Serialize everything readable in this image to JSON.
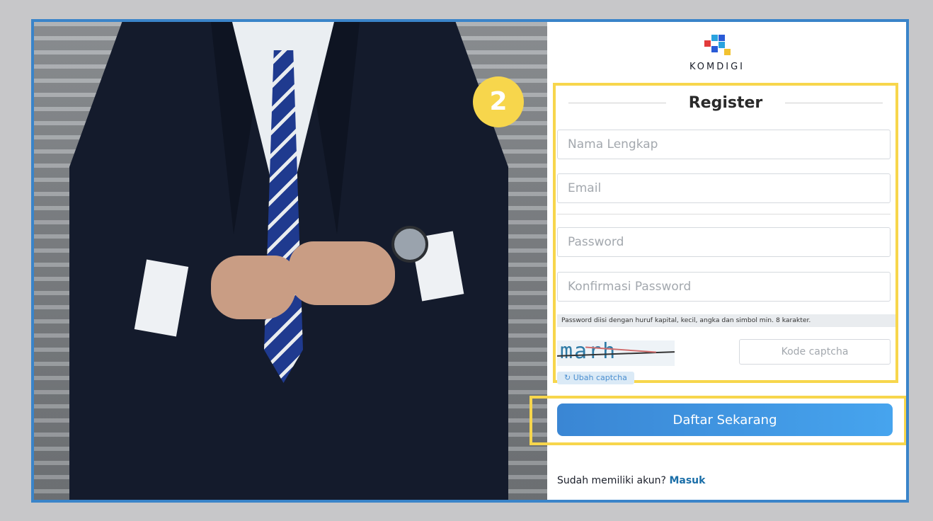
{
  "brand": {
    "name": "KOMDIGI",
    "colors": {
      "frame": "#3a84c9",
      "highlight": "#f7d64c",
      "button": "#3a86d4",
      "link": "#1a6ea8"
    }
  },
  "badge": "2",
  "form": {
    "title": "Register",
    "fields": {
      "name_placeholder": "Nama Lengkap",
      "email_placeholder": "Email",
      "password_placeholder": "Password",
      "confirm_placeholder": "Konfirmasi Password"
    },
    "password_hint": "Password diisi dengan huruf kapital, kecil, angka dan simbol min. 8 karakter.",
    "captcha": {
      "image_text": "marh",
      "input_placeholder": "Kode captcha",
      "refresh_label": "Ubah captcha",
      "refresh_icon": "refresh-icon"
    },
    "submit_label": "Daftar Sekarang",
    "login_prompt": "Sudah memiliki akun?",
    "login_link": "Masuk"
  }
}
